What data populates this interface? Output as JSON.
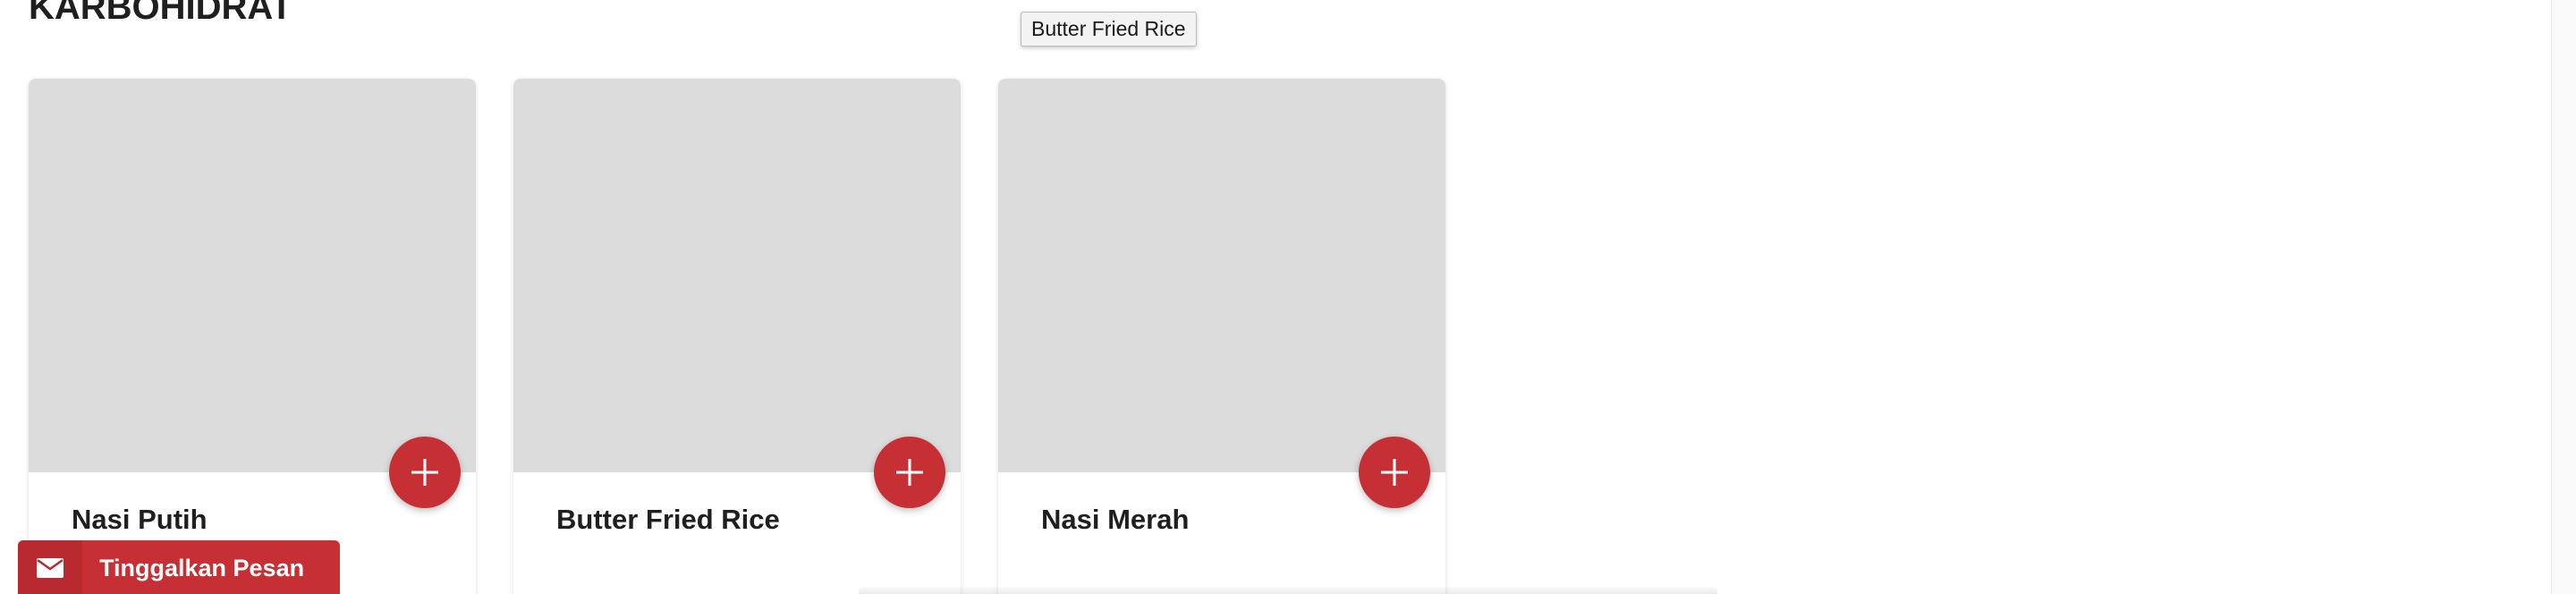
{
  "section": {
    "title": "KARBOHIDRAT"
  },
  "products": [
    {
      "name": "Nasi Putih"
    },
    {
      "name": "Butter Fried Rice"
    },
    {
      "name": "Nasi Merah"
    }
  ],
  "tooltip": {
    "text": "Butter Fried Rice"
  },
  "message_widget": {
    "label": "Tinggalkan Pesan",
    "icon": "envelope-icon"
  },
  "icons": {
    "add": "plus-icon"
  },
  "colors": {
    "accent": "#c62f34",
    "image_placeholder": "#dcdcdc",
    "text": "#1f1f1f"
  }
}
